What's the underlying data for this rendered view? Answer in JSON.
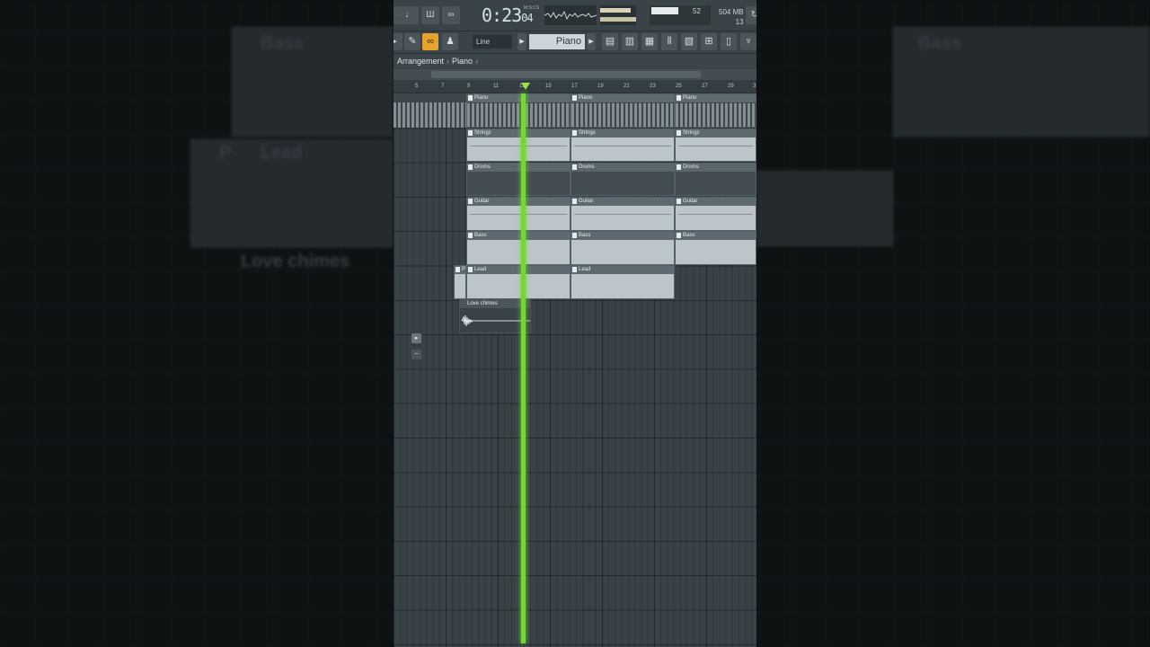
{
  "transport": {
    "time_main": "0:23",
    "time_sub": "04",
    "time_unit": "M:S:CS",
    "cpu_value": "52",
    "mem_value": "504 MB",
    "poly_value": "13"
  },
  "toolbar": {
    "snap_label": "Line",
    "channel_label": "Piano"
  },
  "breadcrumb": {
    "items": [
      "Arrangement",
      "Piano"
    ]
  },
  "ruler": {
    "ticks": [
      "5",
      "7",
      "9",
      "11",
      "13",
      "15",
      "17",
      "19",
      "21",
      "23",
      "25",
      "27",
      "29",
      "3"
    ]
  },
  "clips": {
    "piano": [
      "Piano",
      "Piano",
      "Piano"
    ],
    "strings": [
      "Strings",
      "Strings",
      "Strings"
    ],
    "drums": [
      "Drums",
      "Drums",
      "Drums"
    ],
    "guitar": [
      "Guitar",
      "Guitar",
      "Guitar"
    ],
    "bass": [
      "Bass",
      "Bass",
      "Bass"
    ],
    "lead_p": "P",
    "lead": [
      "Lead",
      "Lead"
    ],
    "audio": "Love chimes"
  },
  "background": {
    "left_bass": "Bass",
    "left_lead_p": "P",
    "left_lead": "Lead",
    "left_love": "Love chimes",
    "right_bass": "Bass"
  },
  "colors": {
    "playhead": "#74d63a",
    "snap_active": "#e8a32c"
  }
}
